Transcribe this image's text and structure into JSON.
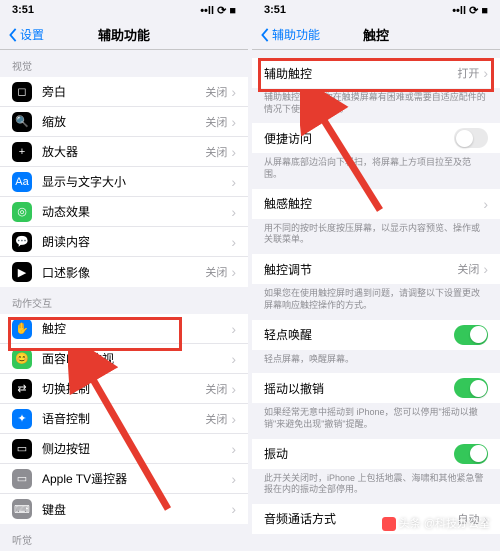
{
  "status": {
    "time": "3:51",
    "ind": "••ll ⟳ ■"
  },
  "left": {
    "back": "设置",
    "title": "辅助功能",
    "sec_vision": "视觉",
    "items_v": [
      {
        "lbl": "旁白",
        "det": "关闭",
        "ic": "◻",
        "c": "#000"
      },
      {
        "lbl": "缩放",
        "det": "关闭",
        "ic": "🔍",
        "c": "#000"
      },
      {
        "lbl": "放大器",
        "det": "关闭",
        "ic": "+",
        "c": "#000"
      },
      {
        "lbl": "显示与文字大小",
        "det": "",
        "ic": "Aa",
        "c": "#007aff"
      },
      {
        "lbl": "动态效果",
        "det": "",
        "ic": "◎",
        "c": "#34c759"
      },
      {
        "lbl": "朗读内容",
        "det": "",
        "ic": "💬",
        "c": "#000"
      },
      {
        "lbl": "口述影像",
        "det": "关闭",
        "ic": "▶",
        "c": "#000"
      }
    ],
    "sec_motion": "动作交互",
    "items_m": [
      {
        "lbl": "触控",
        "det": "",
        "ic": "✋",
        "c": "#007aff"
      },
      {
        "lbl": "面容ID与注视",
        "det": "",
        "ic": "😊",
        "c": "#34c759"
      },
      {
        "lbl": "切换控制",
        "det": "关闭",
        "ic": "⇄",
        "c": "#000"
      },
      {
        "lbl": "语音控制",
        "det": "关闭",
        "ic": "✦",
        "c": "#007aff"
      },
      {
        "lbl": "侧边按钮",
        "det": "",
        "ic": "▭",
        "c": "#000"
      },
      {
        "lbl": "Apple TV遥控器",
        "det": "",
        "ic": "▭",
        "c": "#8e8e93"
      },
      {
        "lbl": "键盘",
        "det": "",
        "ic": "⌨",
        "c": "#8e8e93"
      }
    ],
    "sec_hearing": "听觉"
  },
  "right": {
    "back": "辅助功能",
    "title": "触控",
    "groups": [
      {
        "rows": [
          {
            "lbl": "辅助触控",
            "det": "打开"
          }
        ],
        "help": "辅助触控\" 可让你在触摸屏幕有困难或需要自适应配件的情况下使用 iPhone。"
      },
      {
        "rows": [
          {
            "lbl": "便捷访问",
            "sw": "off"
          }
        ],
        "help": "从屏幕底部边沿向下轻扫，将屏幕上方项目拉至及范围。"
      },
      {
        "rows": [
          {
            "lbl": "触感触控"
          }
        ],
        "help": "用不同的按时长度按压屏幕，以显示内容预览、操作或关联菜单。"
      },
      {
        "rows": [
          {
            "lbl": "触控调节",
            "det": "关闭"
          }
        ],
        "help": "如果您在使用触控屏时遇到问题，请调整以下设置更改屏幕响应触控操作的方式。"
      },
      {
        "rows": [
          {
            "lbl": "轻点唤醒",
            "sw": "on"
          }
        ],
        "help": "轻点屏幕，唤醒屏幕。"
      },
      {
        "rows": [
          {
            "lbl": "摇动以撤销",
            "sw": "on"
          }
        ],
        "help": "如果经常无意中摇动到 iPhone，您可以停用\"摇动以撤销\"来避免出现\"撤销\"提醒。"
      },
      {
        "rows": [
          {
            "lbl": "振动",
            "sw": "on"
          }
        ],
        "help": "此开关关闭时，iPhone 上包括地震、海啸和其他紧急警报在内的振动全部停用。"
      },
      {
        "rows": [
          {
            "lbl": "音频通话方式",
            "det": "自动"
          }
        ]
      }
    ]
  },
  "watermark": "头条 @科技办公室"
}
